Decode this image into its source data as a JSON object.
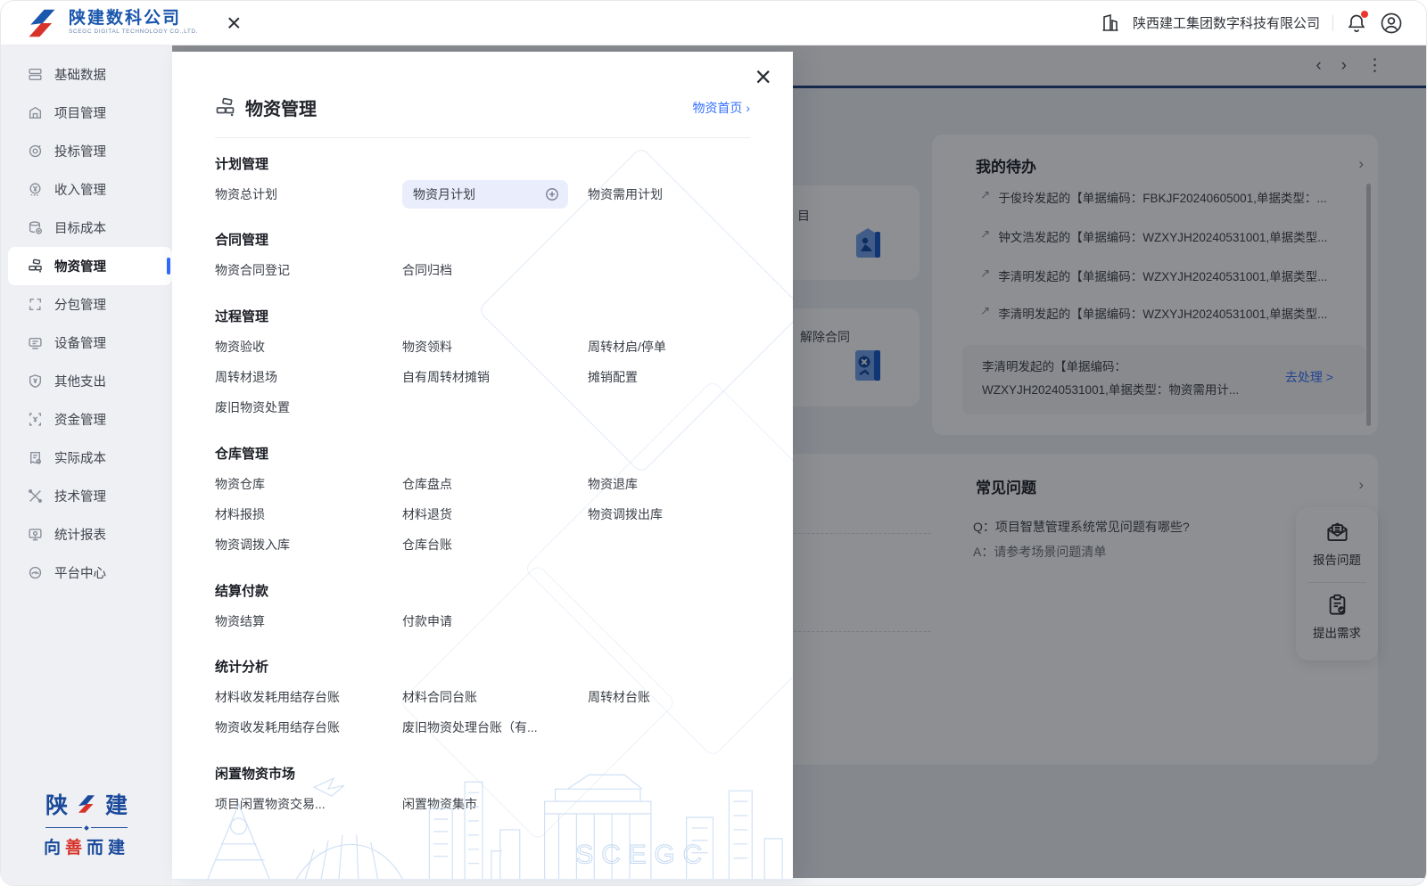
{
  "header": {
    "logo_title": "陕建数科公司",
    "logo_subtitle": "SCEGC DIGITAL TECHNOLOGY CO.,LTD.",
    "close_glyph": "×",
    "company": "陕西建工集团数字科技有限公司"
  },
  "nav": {
    "back": "‹",
    "forward": "›",
    "more": "⋮"
  },
  "sidebar": {
    "items": [
      {
        "label": "基础数据"
      },
      {
        "label": "项目管理"
      },
      {
        "label": "投标管理"
      },
      {
        "label": "收入管理"
      },
      {
        "label": "目标成本"
      },
      {
        "label": "物资管理"
      },
      {
        "label": "分包管理"
      },
      {
        "label": "设备管理"
      },
      {
        "label": "其他支出"
      },
      {
        "label": "资金管理"
      },
      {
        "label": "实际成本"
      },
      {
        "label": "技术管理"
      },
      {
        "label": "统计报表"
      },
      {
        "label": "平台中心"
      }
    ],
    "active_label": "物资管理",
    "footer": {
      "left_char": "陕",
      "right_char": "建",
      "motto": [
        "向",
        "善",
        "而",
        "建"
      ]
    }
  },
  "overlay": {
    "title": "物资管理",
    "home_link": "物资首页 ›",
    "close_glyph": "×",
    "watermark_text": "SCEGC",
    "sections": [
      {
        "title": "计划管理",
        "items": [
          {
            "label": "物资总计划"
          },
          {
            "label": "物资月计划",
            "highlighted": true
          },
          {
            "label": "物资需用计划"
          }
        ]
      },
      {
        "title": "合同管理",
        "items": [
          {
            "label": "物资合同登记"
          },
          {
            "label": "合同归档"
          }
        ]
      },
      {
        "title": "过程管理",
        "items": [
          {
            "label": "物资验收"
          },
          {
            "label": "物资领料"
          },
          {
            "label": "周转材启/停单"
          },
          {
            "label": "周转材退场"
          },
          {
            "label": "自有周转材摊销"
          },
          {
            "label": "摊销配置"
          },
          {
            "label": "废旧物资处置"
          }
        ]
      },
      {
        "title": "仓库管理",
        "items": [
          {
            "label": "物资仓库"
          },
          {
            "label": "仓库盘点"
          },
          {
            "label": "物资退库"
          },
          {
            "label": "材料报损"
          },
          {
            "label": "材料退货"
          },
          {
            "label": "物资调拨出库"
          },
          {
            "label": "物资调拨入库"
          },
          {
            "label": "仓库台账"
          }
        ]
      },
      {
        "title": "结算付款",
        "items": [
          {
            "label": "物资结算"
          },
          {
            "label": "付款申请"
          }
        ]
      },
      {
        "title": "统计分析",
        "items": [
          {
            "label": "材料收发耗用结存台账"
          },
          {
            "label": "材料合同台账"
          },
          {
            "label": "周转材台账"
          },
          {
            "label": "物资收发耗用结存台账"
          },
          {
            "label": "废旧物资处理台账（有..."
          }
        ]
      },
      {
        "title": "闲置物资市场",
        "items": [
          {
            "label": "项目闲置物资交易..."
          },
          {
            "label": "闲置物资集市"
          }
        ]
      }
    ]
  },
  "background": {
    "partial_card_1": {
      "text": "目"
    },
    "partial_card_2": {
      "text": "解除合同"
    },
    "todo": {
      "title": "我的待办",
      "chevron": "›",
      "bullet": "↗",
      "items": [
        {
          "text": "于俊玲发起的【单据编码：FBKJF20240605001,单据类型：..."
        },
        {
          "text": "钟文浩发起的【单据编码：WZXYJH20240531001,单据类型..."
        },
        {
          "text": "李清明发起的【单据编码：WZXYJH20240531001,单据类型..."
        },
        {
          "text": "李清明发起的【单据编码：WZXYJH20240531001,单据类型..."
        }
      ],
      "highlight": {
        "line1": "李清明发起的【单据编码：",
        "line2": "WZXYJH20240531001,单据类型：物资需用计...",
        "action": "去处理 >"
      }
    },
    "faq": {
      "title": "常见问题",
      "chevron": "›",
      "q": "Q：项目智慧管理系统常见问题有哪些?",
      "a": "A：请参考场景问题清单"
    },
    "float_buttons": [
      {
        "label": "报告问题"
      },
      {
        "label": "提出需求"
      }
    ]
  },
  "colors": {
    "accent": "#3370FF",
    "brand_blue": "#1A57AD",
    "brand_red": "#D8332A",
    "active_bar": "#2F6BFE",
    "tab_line": "#1D3F7B",
    "pill_bg": "#E9EDFC"
  }
}
